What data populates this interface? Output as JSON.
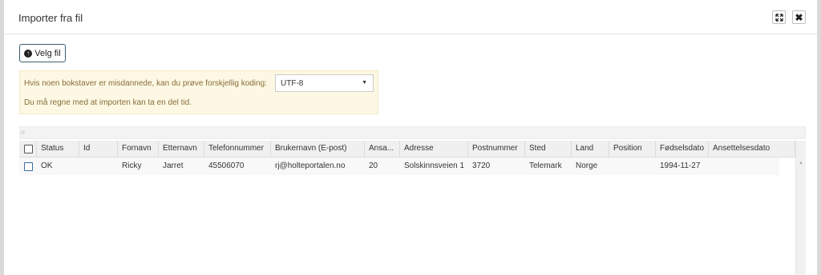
{
  "dialog": {
    "title": "Importer fra fil",
    "close_symbol": "✖"
  },
  "toolbar": {
    "pick_file_label": "Velg fil",
    "pick_file_icon": "upload-circle-icon"
  },
  "notice": {
    "encoding_text": "Hvis noen bokstaver er misdannede, kan du prøve forskjellig koding:",
    "encoding_value": "UTF-8",
    "duration_text": "Du må regne med at importen kan ta en del tid."
  },
  "table": {
    "columns": [
      "Status",
      "Id",
      "Fornavn",
      "Etternavn",
      "Telefonnummer",
      "Brukernavn (E-post)",
      "Ansa...",
      "Adresse",
      "Postnummer",
      "Sted",
      "Land",
      "Position",
      "Fødselsdato",
      "Ansettelsesdato"
    ],
    "rows": [
      [
        "OK",
        "",
        "Ricky",
        "Jarret",
        "45506070",
        "rj@holteportalen.no",
        "20",
        "Solskinnsveien 1",
        "3720",
        "Telemark",
        "Norge",
        "",
        "1994-11-27",
        ""
      ]
    ]
  }
}
